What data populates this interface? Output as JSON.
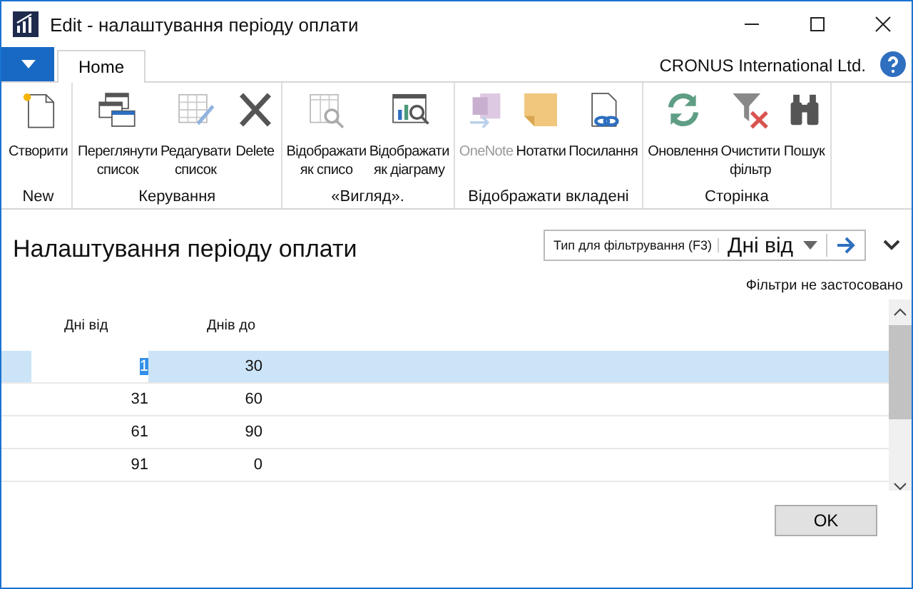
{
  "window": {
    "title": "Edit - налаштування періоду оплати"
  },
  "tabs": [
    {
      "label": "Home",
      "selected": true
    }
  ],
  "company": "CRONUS International Ltd.",
  "ribbon": [
    {
      "group": "New",
      "buttons": [
        {
          "kind": "new",
          "lines": [
            "Створити"
          ],
          "disabled": false
        }
      ]
    },
    {
      "group": "Керування",
      "buttons": [
        {
          "kind": "view-list",
          "lines": [
            "Переглянути",
            "список"
          ],
          "disabled": false
        },
        {
          "kind": "edit-list",
          "lines": [
            "Редагувати",
            "список"
          ],
          "disabled": false
        },
        {
          "kind": "delete",
          "lines": [
            "Delete"
          ],
          "disabled": false
        }
      ]
    },
    {
      "group": "«Вигляд».",
      "buttons": [
        {
          "kind": "show-list",
          "lines": [
            "Відображати",
            "як списо"
          ],
          "disabled": false
        },
        {
          "kind": "show-chart",
          "lines": [
            "Відображати",
            "як діаграму"
          ],
          "disabled": false
        }
      ]
    },
    {
      "group": "Відображати вкладені",
      "buttons": [
        {
          "kind": "onenote",
          "lines": [
            "OneNote"
          ],
          "disabled": true
        },
        {
          "kind": "notes",
          "lines": [
            "Нотатки"
          ],
          "disabled": false
        },
        {
          "kind": "links",
          "lines": [
            "Посилання"
          ],
          "disabled": false
        }
      ]
    },
    {
      "group": "Сторінка",
      "buttons": [
        {
          "kind": "refresh",
          "lines": [
            "Оновлення"
          ],
          "disabled": false
        },
        {
          "kind": "clear-filter",
          "lines": [
            "Очистити",
            "фільтр"
          ],
          "disabled": false
        },
        {
          "kind": "find",
          "lines": [
            "Пошук"
          ],
          "disabled": false
        }
      ]
    }
  ],
  "page_title": "Налаштування періоду оплати",
  "filter": {
    "label": "Тип для фільтрування (F3)",
    "value": "Дні від"
  },
  "filter_status": "Фільтри не застосовано",
  "table": {
    "columns": [
      "Дні від",
      "Днів до"
    ],
    "rows": [
      {
        "cells": [
          "1",
          "30"
        ],
        "selected": true
      },
      {
        "cells": [
          "31",
          "60"
        ],
        "selected": false
      },
      {
        "cells": [
          "61",
          "90"
        ],
        "selected": false
      },
      {
        "cells": [
          "91",
          "0"
        ],
        "selected": false
      }
    ]
  },
  "buttons": [
    "OK"
  ]
}
